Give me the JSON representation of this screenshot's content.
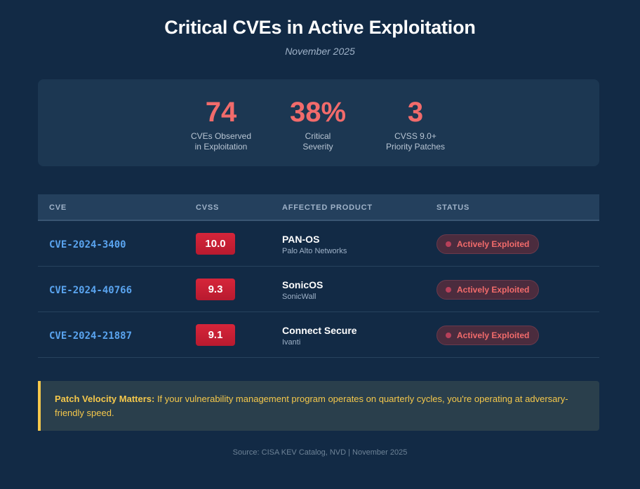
{
  "header": {
    "title": "Critical CVEs in Active Exploitation",
    "subtitle": "November 2025"
  },
  "stats": [
    {
      "value": "74",
      "label_line1": "CVEs Observed",
      "label_line2": "in Exploitation"
    },
    {
      "value": "38%",
      "label_line1": "Critical",
      "label_line2": "Severity"
    },
    {
      "value": "3",
      "label_line1": "CVSS 9.0+",
      "label_line2": "Priority Patches"
    }
  ],
  "table": {
    "columns": [
      "CVE",
      "CVSS",
      "AFFECTED PRODUCT",
      "STATUS"
    ],
    "rows": [
      {
        "cve": "CVE-2024-3400",
        "cvss": "10.0",
        "product": "PAN-OS",
        "vendor": "Palo Alto Networks",
        "status": "Actively Exploited"
      },
      {
        "cve": "CVE-2024-40766",
        "cvss": "9.3",
        "product": "SonicOS",
        "vendor": "SonicWall",
        "status": "Actively Exploited"
      },
      {
        "cve": "CVE-2024-21887",
        "cvss": "9.1",
        "product": "Connect Secure",
        "vendor": "Ivanti",
        "status": "Actively Exploited"
      }
    ]
  },
  "callout": {
    "strong": "Patch Velocity Matters:",
    "text": " If your vulnerability management program operates on quarterly cycles, you're operating at adversary-friendly speed."
  },
  "footer": {
    "source": "Source: CISA KEV Catalog, NVD | November 2025"
  },
  "colors": {
    "background": "#122a45",
    "accent_red": "#f26b6b",
    "cve_blue": "#5aa4ef",
    "callout_yellow": "#f5c84b"
  }
}
